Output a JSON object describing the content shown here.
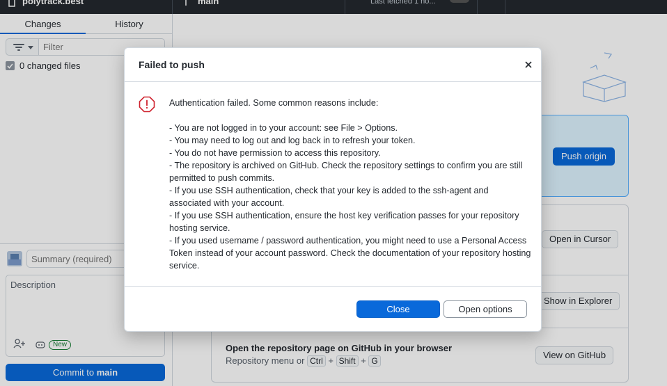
{
  "topbar": {
    "repository": "polytrack.best",
    "branch": "main",
    "fetch_status": "Last fetched 1 ho..."
  },
  "sidebar": {
    "tabs": [
      {
        "label": "Changes",
        "active": true
      },
      {
        "label": "History",
        "active": false
      }
    ],
    "filter_placeholder": "Filter",
    "changed_files": "0 changed files",
    "summary_placeholder": "Summary (required)",
    "description_placeholder": "Description",
    "new_badge": "New",
    "commit_button_prefix": "Commit to ",
    "commit_button_branch": "main"
  },
  "main": {
    "push_button": "Push origin",
    "open_editor_button": "Open in Cursor",
    "show_explorer_button": "Show in Explorer",
    "github_row_title": "Open the repository page on GitHub in your browser",
    "github_row_sub_prefix": "Repository menu or",
    "github_row_keys": [
      "Ctrl",
      "Shift",
      "G"
    ],
    "view_github_button": "View on GitHub"
  },
  "dialog": {
    "title": "Failed to push",
    "intro": "Authentication failed. Some common reasons include:",
    "reasons": [
      "- You are not logged in to your account: see File > Options.",
      "- You may need to log out and log back in to refresh your token.",
      "- You do not have permission to access this repository.",
      "- The repository is archived on GitHub. Check the repository settings to confirm you are still permitted to push commits.",
      "- If you use SSH authentication, check that your key is added to the ssh-agent and associated with your account.",
      "- If you use SSH authentication, ensure the host key verification passes for your repository hosting service.",
      "- If you used username / password authentication, you might need to use a Personal Access Token instead of your account password. Check the documentation of your repository hosting service."
    ],
    "close_button": "Close",
    "open_options_button": "Open options"
  },
  "colors": {
    "accent": "#0969da",
    "error": "#cf222e",
    "topbar": "#24292e"
  },
  "icons": [
    "repo-icon",
    "branch-icon",
    "filter-icon",
    "chevron-down-icon",
    "avatar-icon",
    "add-coauthor-icon",
    "copilot-icon",
    "close-icon",
    "error-icon"
  ]
}
